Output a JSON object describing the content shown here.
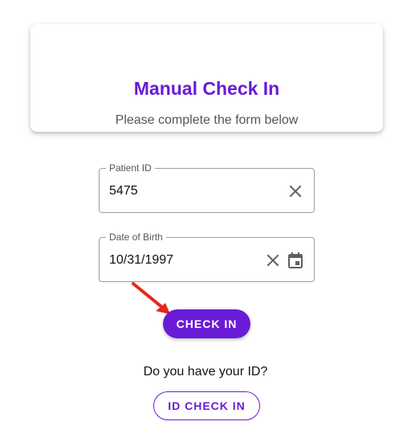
{
  "header": {
    "title": "Manual Check In",
    "subtitle": "Please complete the form below"
  },
  "form": {
    "patient_id": {
      "label": "Patient ID",
      "value": "5475",
      "icons": [
        "clear-icon"
      ]
    },
    "date_of_birth": {
      "label": "Date of Birth",
      "value": "10/31/1997",
      "icons": [
        "clear-icon",
        "calendar-icon"
      ]
    }
  },
  "actions": {
    "check_in_label": "CHECK IN",
    "id_prompt": "Do you have your ID?",
    "id_check_in_label": "ID CHECK IN"
  },
  "annotation": {
    "type": "arrow",
    "target": "check-in-button",
    "color": "#e8261c"
  },
  "colors": {
    "accent": "#6a1bd6",
    "text": "#111111",
    "muted": "#555555",
    "border": "#9e9e9e"
  }
}
